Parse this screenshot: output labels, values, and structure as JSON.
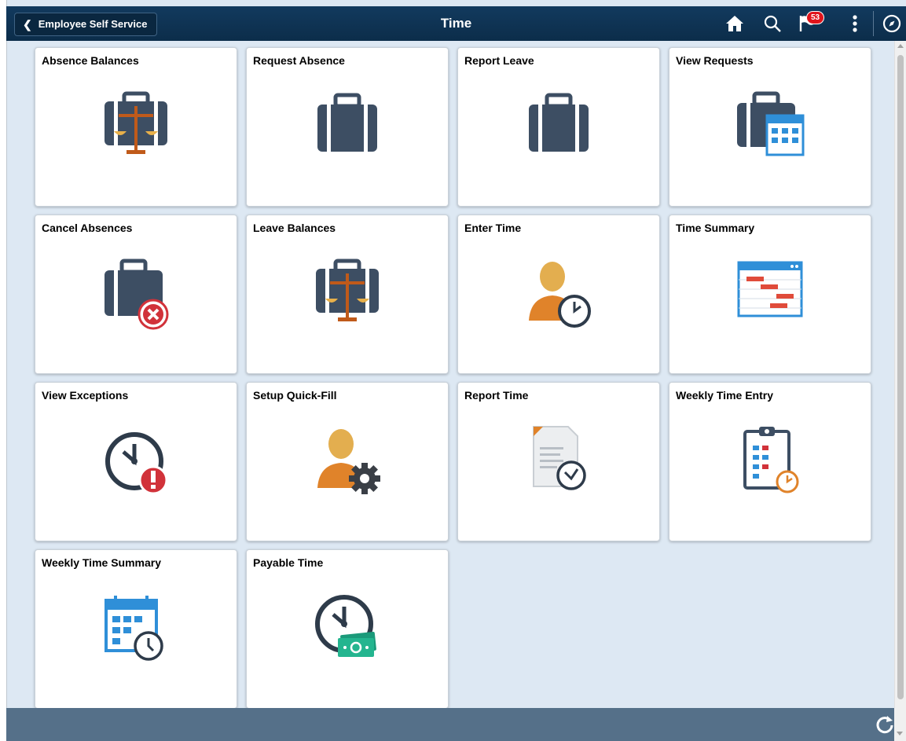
{
  "header": {
    "back_label": "Employee Self Service",
    "title": "Time",
    "notification_count": "53",
    "icons": [
      "home-icon",
      "search-icon",
      "notifications-flag-icon",
      "actions-menu-icon",
      "navbar-compass-icon"
    ]
  },
  "tiles": [
    {
      "label": "Absence Balances",
      "icon": "briefcase-scales-icon"
    },
    {
      "label": "Request Absence",
      "icon": "briefcase-icon"
    },
    {
      "label": "Report Leave",
      "icon": "briefcase-icon"
    },
    {
      "label": "View Requests",
      "icon": "briefcase-calendar-icon"
    },
    {
      "label": "Cancel Absences",
      "icon": "briefcase-cancel-icon"
    },
    {
      "label": "Leave Balances",
      "icon": "briefcase-scales-icon"
    },
    {
      "label": "Enter Time",
      "icon": "person-clock-icon"
    },
    {
      "label": "Time Summary",
      "icon": "gantt-calendar-icon"
    },
    {
      "label": "View Exceptions",
      "icon": "clock-exclamation-icon"
    },
    {
      "label": "Setup Quick-Fill",
      "icon": "person-gear-icon"
    },
    {
      "label": "Report Time",
      "icon": "document-clock-icon"
    },
    {
      "label": "Weekly Time Entry",
      "icon": "clipboard-clock-icon"
    },
    {
      "label": "Weekly Time Summary",
      "icon": "calendar-clock-icon"
    },
    {
      "label": "Payable Time",
      "icon": "clock-money-icon"
    }
  ],
  "footer": {
    "icons": [
      "refresh-icon"
    ]
  },
  "colors": {
    "header_bg": "#0c2d4a",
    "page_bg": "#dde8f3",
    "footer_bg": "#557089",
    "icon_navy": "#3d4e63",
    "icon_orange": "#e0832a",
    "icon_blue": "#2f8fd8",
    "alert_red": "#d1323a"
  }
}
